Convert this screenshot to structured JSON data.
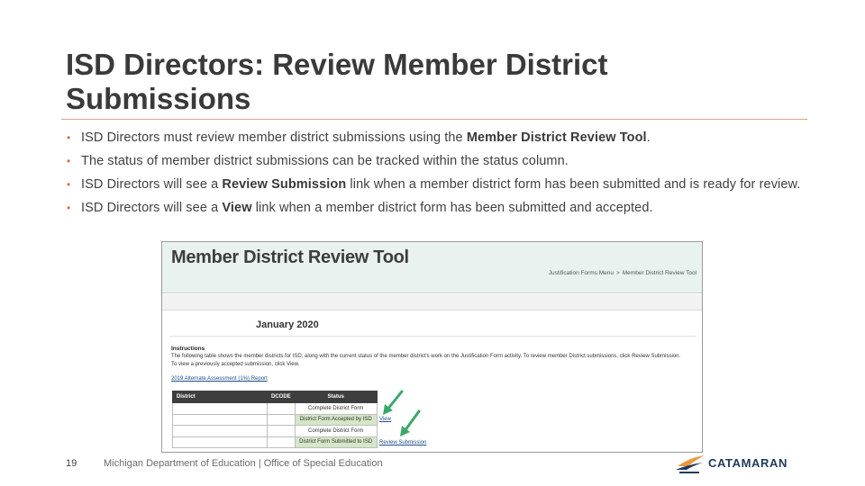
{
  "slide": {
    "title_line1": "ISD Directors: Review Member District",
    "title_line2": "Submissions",
    "bullets": {
      "b1_pre": "ISD Directors must review member district submissions using the ",
      "b1_bold": "Member District Review Tool",
      "b1_post": ".",
      "b2": "The status of member district submissions can be tracked within the status column.",
      "b3_pre": "ISD Directors will see a ",
      "b3_bold": "Review Submission",
      "b3_post": " link when a member district form has been submitted and is ready for review.",
      "b4_pre": "ISD Directors will see a ",
      "b4_bold": "View",
      "b4_post": " link when a member district form has been submitted and accepted."
    },
    "footer": {
      "page_number": "19",
      "org": "Michigan Department of Education | Office of Special Education"
    },
    "logo_text": "CATAMARAN"
  },
  "screenshot": {
    "tool_title": "Member District Review Tool",
    "breadcrumb": [
      "Justification Forms Menu",
      "Member District Review Tool"
    ],
    "breadcrumb_sep": ">",
    "month": "January 2020",
    "instructions_heading": "Instructions",
    "instructions_text": "The following table shows the member districts for          ISD, along with the current status of the member district's work on the Justification Form activity. To review member District submissions, click Review Submission. To view a previously accepted submission, click View.",
    "report_link": "2019 Alternate Assessment (1%) Report",
    "table": {
      "headers": [
        "District",
        "DCODE",
        "Status"
      ],
      "rows": [
        {
          "district": "",
          "dcode": "",
          "status": "Complete District Form",
          "highlight": false,
          "link": ""
        },
        {
          "district": "",
          "dcode": "",
          "status": "District Form Accepted by ISD",
          "highlight": true,
          "link": "View"
        },
        {
          "district": "",
          "dcode": "",
          "status": "Complete District Form",
          "highlight": false,
          "link": ""
        },
        {
          "district": "",
          "dcode": "",
          "status": "District Form Submitted to ISD",
          "highlight": true,
          "link": "Review Submission"
        }
      ]
    }
  },
  "colors": {
    "accent": "#d66f4a",
    "header_bg": "#e9f2ee",
    "table_header": "#3e3e3e",
    "highlight_green": "#d4e7c7",
    "arrow_green": "#3aa86b",
    "logo_navy": "#1f3b5c",
    "logo_orange": "#e8983a"
  },
  "icons": {
    "arrows": "green-pointer-arrow",
    "logo": "sailboat-logo-icon"
  }
}
